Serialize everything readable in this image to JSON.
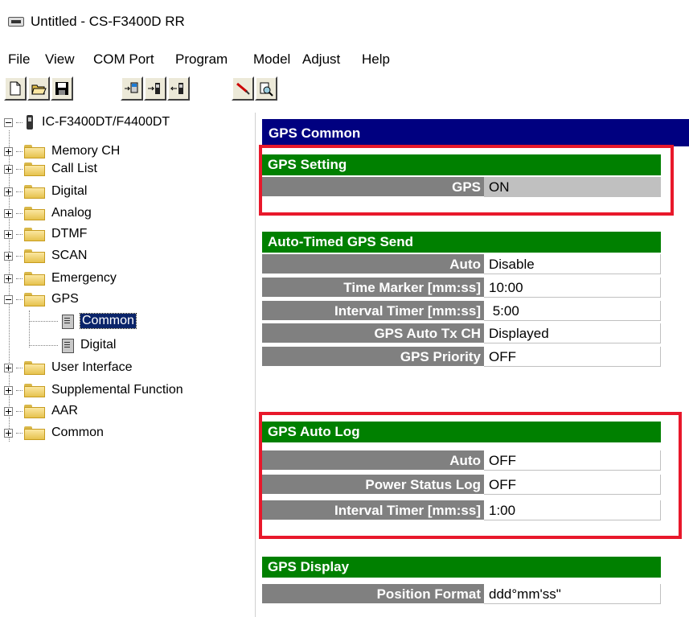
{
  "window": {
    "title": "Untitled - CS-F3400D RR"
  },
  "menu": [
    "File",
    "View",
    "COM Port",
    "Program",
    "Model",
    "Adjust",
    "Help"
  ],
  "toolbar_icons": [
    "new-icon",
    "open-icon",
    "save-icon",
    "read-radio-icon",
    "write-radio-icon",
    "clone-radio-icon",
    "tools-icon",
    "print-preview-icon"
  ],
  "tree": {
    "root": "IC-F3400DT/F4400DT",
    "items": [
      {
        "label": "Memory CH"
      },
      {
        "label": "Call List"
      },
      {
        "label": "Digital"
      },
      {
        "label": "Analog"
      },
      {
        "label": "DTMF"
      },
      {
        "label": "SCAN"
      },
      {
        "label": "Emergency"
      },
      {
        "label": "GPS",
        "children": [
          "Common",
          "Digital"
        ]
      },
      {
        "label": "User Interface"
      },
      {
        "label": "Supplemental Function"
      },
      {
        "label": "AAR"
      },
      {
        "label": "Common"
      }
    ],
    "selected": "Common"
  },
  "panel": {
    "title": "GPS Common",
    "sections": [
      {
        "title": "GPS Setting",
        "rows": [
          {
            "label": "GPS",
            "value": "ON"
          }
        ]
      },
      {
        "title": "Auto-Timed GPS Send",
        "rows": [
          {
            "label": "Auto",
            "value": "Disable"
          },
          {
            "label": "Time Marker [mm:ss]",
            "value": "10:00"
          },
          {
            "label": "Interval Timer [mm:ss]",
            "value": " 5:00"
          },
          {
            "label": "GPS Auto Tx CH",
            "value": "Displayed"
          },
          {
            "label": "GPS Priority",
            "value": "OFF"
          }
        ]
      },
      {
        "title": "GPS Auto Log",
        "rows": [
          {
            "label": "Auto",
            "value": "OFF"
          },
          {
            "label": "Power Status Log",
            "value": "OFF"
          },
          {
            "label": "Interval Timer [mm:ss]",
            "value": "1:00"
          }
        ]
      },
      {
        "title": "GPS Display",
        "rows": [
          {
            "label": "Position Format",
            "value": "ddd°mm'ss\""
          }
        ]
      }
    ]
  },
  "colors": {
    "title_bar": "#000080",
    "section_header": "#008000",
    "label_bg": "#808080",
    "highlight": "#e8182b"
  }
}
